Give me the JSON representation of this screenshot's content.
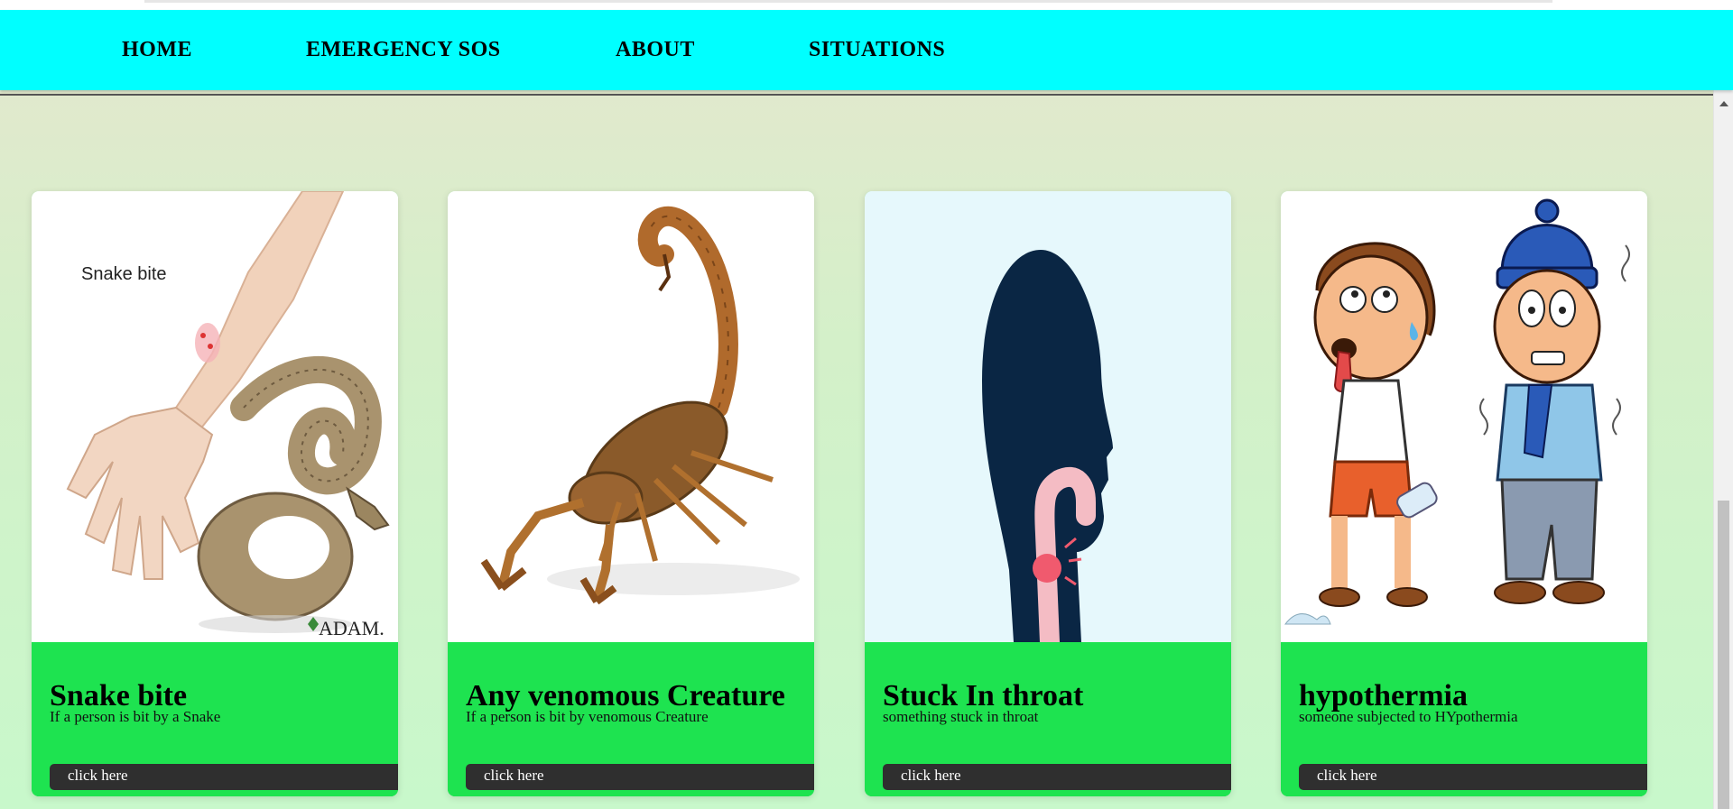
{
  "nav": {
    "items": [
      {
        "label": "HOME"
      },
      {
        "label": "EMERGENCY SOS"
      },
      {
        "label": "ABOUT"
      },
      {
        "label": "SITUATIONS"
      }
    ]
  },
  "colors": {
    "navbar_bg": "#00ffff",
    "card_footer": "#1ee350",
    "button_bg": "#2f2f2f"
  },
  "cards": [
    {
      "title": "Snake bite",
      "text": "If a person is bit by a Snake",
      "button": "click here",
      "image_caption": "Snake bite",
      "image_credit": "ADAM.",
      "image": "snake-bite-illustration"
    },
    {
      "title": "Any venomous Creature",
      "text": "If a person is bit by venomous Creature",
      "button": "click here",
      "image": "scorpion-photo"
    },
    {
      "title": "Stuck In throat",
      "text": "something stuck in throat",
      "button": "click here",
      "image": "choking-throat-illustration"
    },
    {
      "title": "hypothermia",
      "text": "someone subjected to HYpothermia",
      "button": "click here",
      "image": "hypothermia-cartoon"
    }
  ]
}
